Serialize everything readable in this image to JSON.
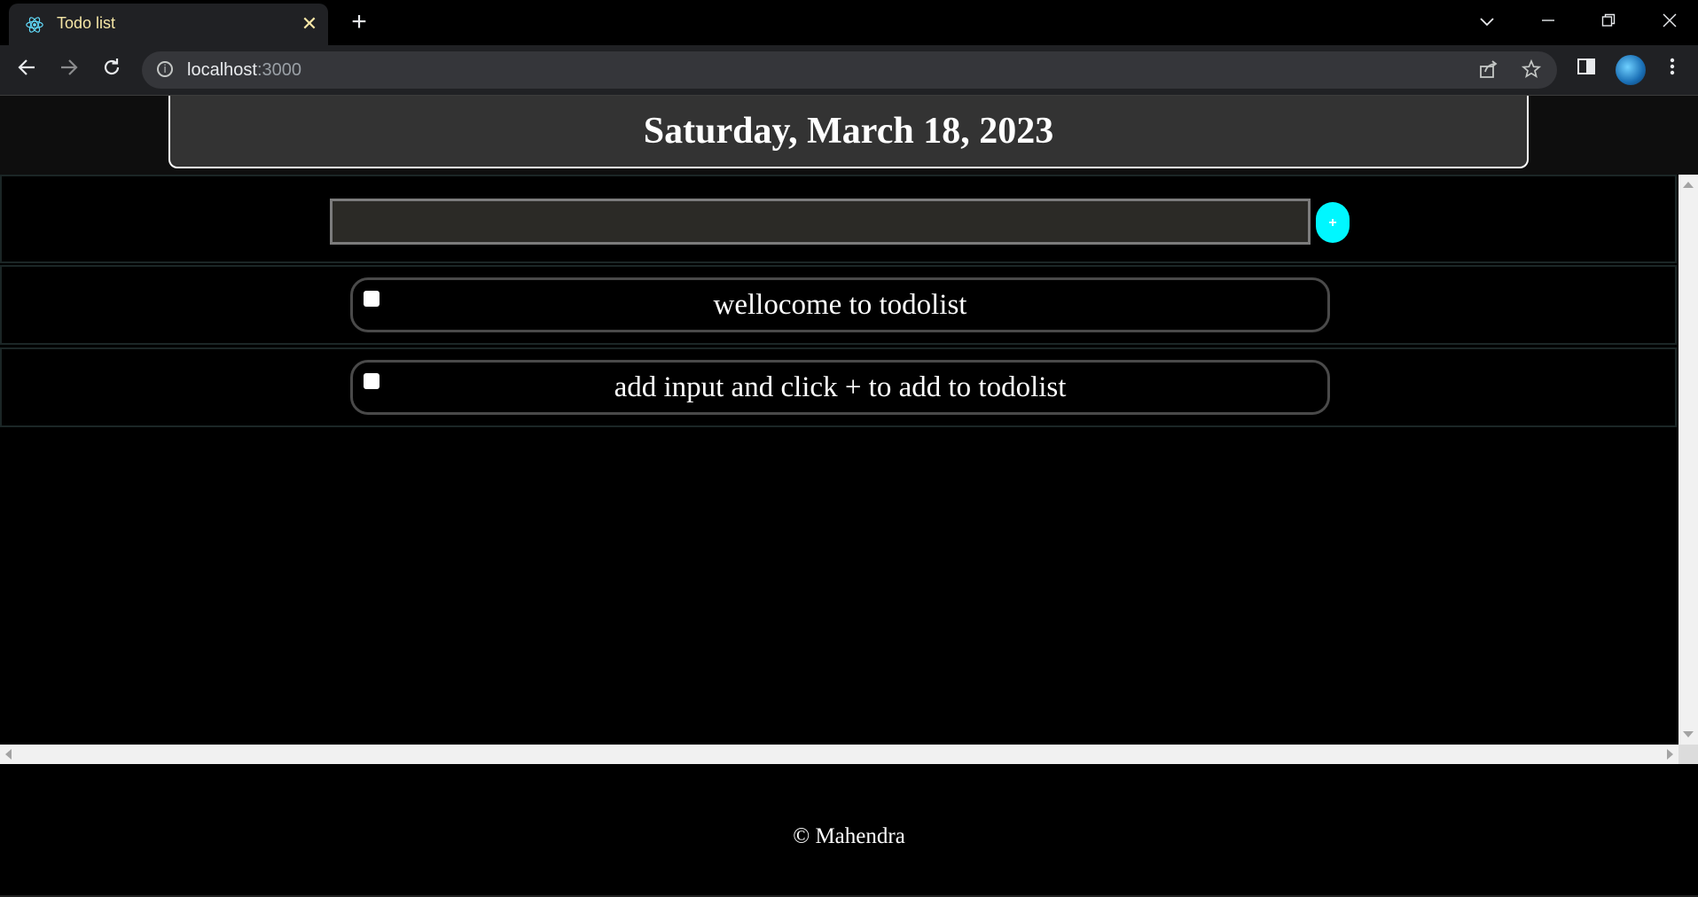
{
  "browser": {
    "tab": {
      "title": "Todo list",
      "icon": "react-icon"
    },
    "address": {
      "host": "localhost",
      "port": ":3000"
    }
  },
  "app": {
    "date": "Saturday, March 18, 2023",
    "input": {
      "value": "",
      "placeholder": ""
    },
    "add_button_label": "+",
    "todos": [
      {
        "text": "wellocome to todolist",
        "checked": false
      },
      {
        "text": "add input and click + to add to todolist",
        "checked": false
      }
    ],
    "footer": "© Mahendra"
  },
  "colors": {
    "background": "#000000",
    "header_box": "#333333",
    "accent": "#00f7ff",
    "tab_title": "#f5e6a6"
  }
}
